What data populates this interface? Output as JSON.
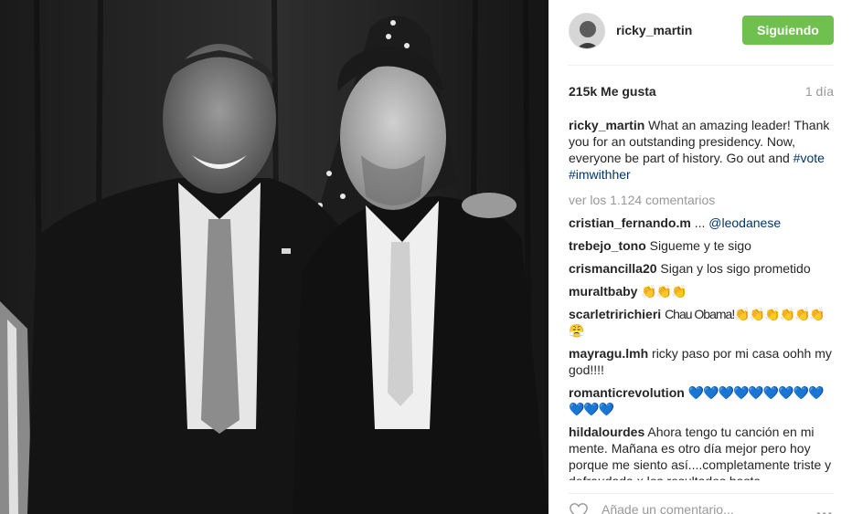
{
  "post": {
    "username": "ricky_martin",
    "follow_label": "Siguiendo",
    "likes": "215k Me gusta",
    "time_ago": "1 día",
    "caption": {
      "user": "ricky_martin",
      "text": "What an amazing leader! Thank you for an outstanding presidency. Now, everyone be part of history. Go out and",
      "hashtags": [
        "#vote",
        "#imwithher"
      ]
    },
    "view_all": "ver los 1.124 comentarios",
    "comments": [
      {
        "user": "cristian_fernando.m",
        "text": "...",
        "mention": "@leodanese"
      },
      {
        "user": "trebejo_tono",
        "text": "Sigueme y te sigo"
      },
      {
        "user": "crismancilla20",
        "text": "Sigan y los sigo prometido"
      },
      {
        "user": "muraltbaby",
        "text": "👏👏👏"
      },
      {
        "user": "scarletririchieri",
        "text": "Chau Obama!👏👏👏👏👏👏😤"
      },
      {
        "user": "mayragu.lmh",
        "text": "ricky paso por mi casa oohh my god!!!!"
      },
      {
        "user": "romanticrevolution",
        "text": "💙💙💙💙💙💙💙💙💙💙💙💙"
      },
      {
        "user": "hildalourdes",
        "text": "Ahora tengo tu canción en mi mente. Mañana es otro día mejor pero hoy porque me siento así....completamente triste y defraudada x los resultados hasta ahora...venciendo el odio sobre el amor y"
      }
    ],
    "add_comment_placeholder": "Añade un comentario...",
    "icons": {
      "heart": "heart-icon",
      "more": "more-options-icon"
    },
    "colors": {
      "follow_bg": "#70c050",
      "hashtag": "#003569",
      "muted": "#999999"
    }
  }
}
